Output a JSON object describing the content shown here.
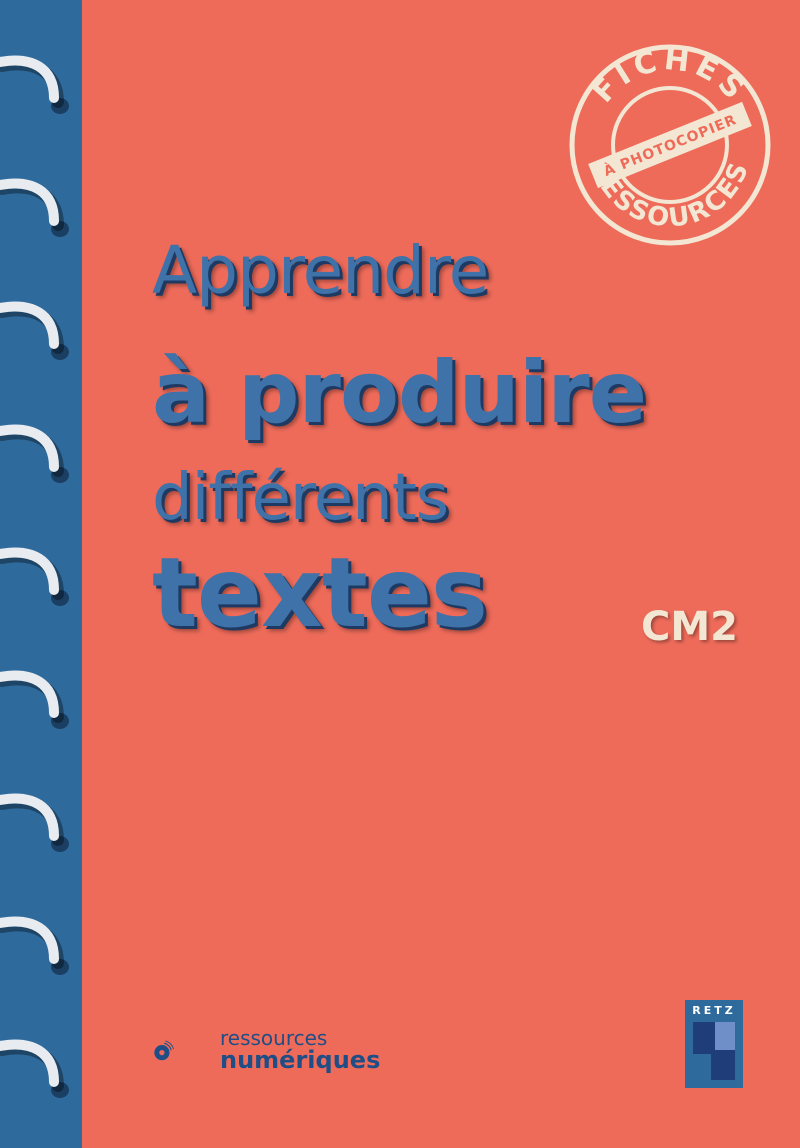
{
  "cover": {
    "title_lines": [
      "Apprendre",
      "à produire",
      "différents",
      "textes"
    ],
    "level": "CM2",
    "stamp": {
      "top": "FICHES",
      "middle": "À PHOTOCOPIER",
      "bottom": "RESSOURCES"
    },
    "digital_resources": {
      "line1": "ressources",
      "line2": "numériques"
    },
    "publisher": "RETZ",
    "colors": {
      "background": "#EE6B5A",
      "spine": "#2F6A9C",
      "title": "#3F72A8",
      "stamp": "#F3E7D3"
    }
  }
}
